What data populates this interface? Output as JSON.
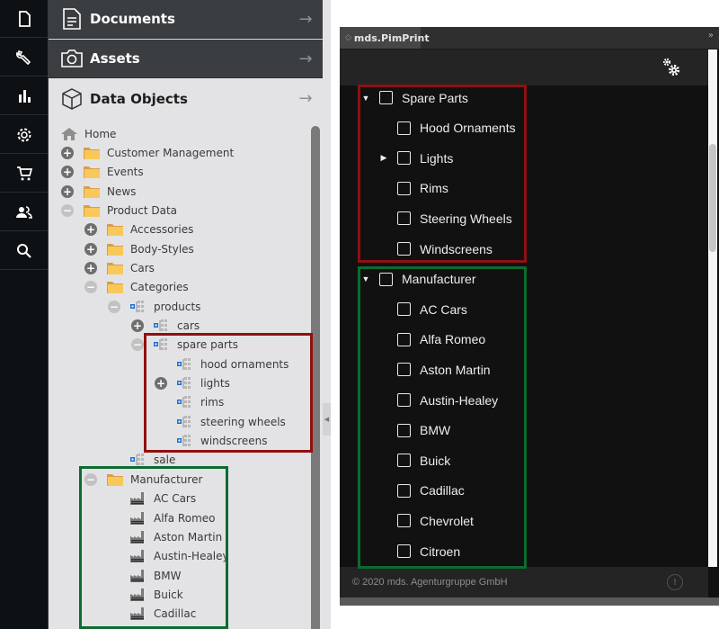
{
  "left_app": {
    "rail": [
      {
        "icon": "document-icon"
      },
      {
        "icon": "wrench-icon"
      },
      {
        "icon": "bar-chart-icon"
      },
      {
        "icon": "gear-icon"
      },
      {
        "icon": "cart-icon"
      },
      {
        "icon": "users-icon"
      },
      {
        "icon": "search-icon"
      }
    ],
    "panels": {
      "documents": {
        "label": "Documents",
        "icon": "document-lines-icon"
      },
      "assets": {
        "label": "Assets",
        "icon": "camera-icon"
      },
      "data_objects": {
        "label": "Data Objects",
        "icon": "cube-icon"
      }
    },
    "tree": [
      {
        "label": "Home",
        "toggle": "none",
        "icon": "home",
        "level": 0
      },
      {
        "label": "Customer Management",
        "toggle": "plus",
        "icon": "folder",
        "level": 0
      },
      {
        "label": "Events",
        "toggle": "plus",
        "icon": "folder",
        "level": 0
      },
      {
        "label": "News",
        "toggle": "plus",
        "icon": "folder",
        "level": 0
      },
      {
        "label": "Product Data",
        "toggle": "minus",
        "icon": "folder",
        "level": 0
      },
      {
        "label": "Accessories",
        "toggle": "plus",
        "icon": "folder",
        "level": 1
      },
      {
        "label": "Body-Styles",
        "toggle": "plus",
        "icon": "folder",
        "level": 1
      },
      {
        "label": "Cars",
        "toggle": "plus",
        "icon": "folder",
        "level": 1
      },
      {
        "label": "Categories",
        "toggle": "minus",
        "icon": "folder",
        "level": 1
      },
      {
        "label": "products",
        "toggle": "minus",
        "icon": "category",
        "level": 2
      },
      {
        "label": "cars",
        "toggle": "plus",
        "icon": "category",
        "level": 3
      },
      {
        "label": "spare parts",
        "toggle": "minus",
        "icon": "category",
        "level": 3
      },
      {
        "label": "hood ornaments",
        "toggle": "none",
        "icon": "category",
        "level": 4
      },
      {
        "label": "lights",
        "toggle": "plus",
        "icon": "category",
        "level": 4
      },
      {
        "label": "rims",
        "toggle": "none",
        "icon": "category",
        "level": 4
      },
      {
        "label": "steering wheels",
        "toggle": "none",
        "icon": "category",
        "level": 4
      },
      {
        "label": "windscreens",
        "toggle": "none",
        "icon": "category",
        "level": 4
      },
      {
        "label": "sale",
        "toggle": "none",
        "icon": "category",
        "level": 2
      },
      {
        "label": "Manufacturer",
        "toggle": "minus",
        "icon": "folder",
        "level": 1
      },
      {
        "label": "AC Cars",
        "toggle": "none",
        "icon": "factory",
        "level": 2
      },
      {
        "label": "Alfa Romeo",
        "toggle": "none",
        "icon": "factory",
        "level": 2
      },
      {
        "label": "Aston Martin",
        "toggle": "none",
        "icon": "factory",
        "level": 2
      },
      {
        "label": "Austin-Healey",
        "toggle": "none",
        "icon": "factory",
        "level": 2
      },
      {
        "label": "BMW",
        "toggle": "none",
        "icon": "factory",
        "level": 2
      },
      {
        "label": "Buick",
        "toggle": "none",
        "icon": "factory",
        "level": 2
      },
      {
        "label": "Cadillac",
        "toggle": "none",
        "icon": "factory",
        "level": 2
      }
    ]
  },
  "right_panel": {
    "tab_label": "mds.PimPrint",
    "expand_label": "»",
    "settings_icon": "gears-icon",
    "rows": [
      {
        "label": "Spare Parts",
        "caret": "down",
        "level": 0,
        "checked": false
      },
      {
        "label": "Hood Ornaments",
        "caret": "",
        "level": 1,
        "checked": false
      },
      {
        "label": "Lights",
        "caret": "right",
        "level": 1,
        "checked": false
      },
      {
        "label": "Rims",
        "caret": "",
        "level": 1,
        "checked": false
      },
      {
        "label": "Steering Wheels",
        "caret": "",
        "level": 1,
        "checked": false
      },
      {
        "label": "Windscreens",
        "caret": "",
        "level": 1,
        "checked": false
      },
      {
        "label": "Manufacturer",
        "caret": "down",
        "level": 0,
        "checked": false
      },
      {
        "label": "AC Cars",
        "caret": "",
        "level": 1,
        "checked": false
      },
      {
        "label": "Alfa Romeo",
        "caret": "",
        "level": 1,
        "checked": false
      },
      {
        "label": "Aston Martin",
        "caret": "",
        "level": 1,
        "checked": false
      },
      {
        "label": "Austin-Healey",
        "caret": "",
        "level": 1,
        "checked": false
      },
      {
        "label": "BMW",
        "caret": "",
        "level": 1,
        "checked": false
      },
      {
        "label": "Buick",
        "caret": "",
        "level": 1,
        "checked": false
      },
      {
        "label": "Cadillac",
        "caret": "",
        "level": 1,
        "checked": false
      },
      {
        "label": "Chevrolet",
        "caret": "",
        "level": 1,
        "checked": false
      },
      {
        "label": "Citroen",
        "caret": "",
        "level": 1,
        "checked": false
      }
    ],
    "footer_text": "© 2020 mds. Agenturgruppe GmbH",
    "status_icon": "refresh-alert-icon"
  },
  "colors": {
    "highlight_red": "#8f1010",
    "highlight_green": "#0c6b2e",
    "folder": "#f8c95a",
    "category_accent": "#1a6fd6"
  }
}
